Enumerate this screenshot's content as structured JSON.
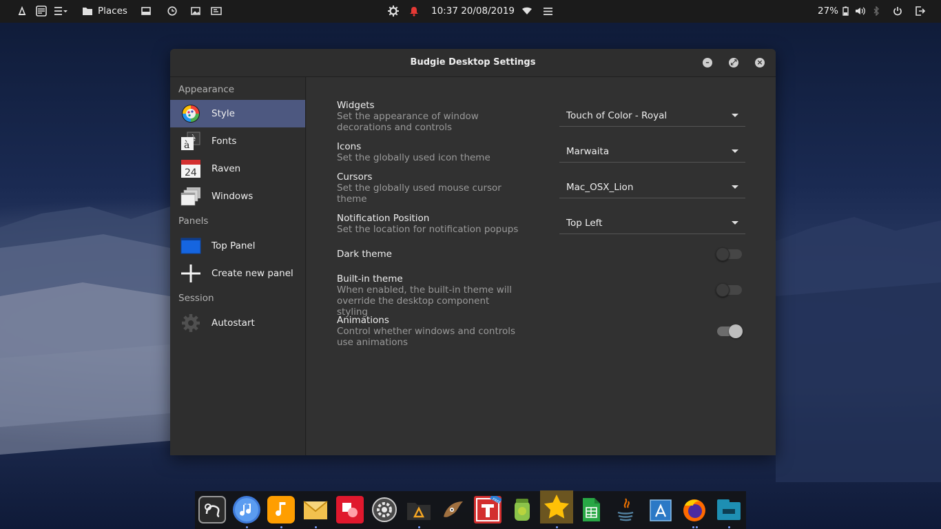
{
  "topbar": {
    "places_label": "Places",
    "clock": "10:37 20/08/2019",
    "battery": "27%"
  },
  "window": {
    "title": "Budgie Desktop Settings"
  },
  "sidebar": {
    "sections": [
      {
        "header": "Appearance"
      },
      {
        "header": "Panels"
      },
      {
        "header": "Session"
      }
    ],
    "items": [
      {
        "label": "Style",
        "icon": "palette-icon",
        "active": true
      },
      {
        "label": "Fonts",
        "icon": "font-icon"
      },
      {
        "label": "Raven",
        "icon": "calendar-icon",
        "calendar_day": "24"
      },
      {
        "label": "Windows",
        "icon": "windows-icon"
      },
      {
        "label": "Top Panel",
        "icon": "panel-icon"
      },
      {
        "label": "Create new panel",
        "icon": "plus-icon"
      },
      {
        "label": "Autostart",
        "icon": "gear-icon"
      }
    ]
  },
  "settings": {
    "widgets": {
      "title": "Widgets",
      "desc": "Set the appearance of window decorations and controls",
      "value": "Touch of Color - Royal"
    },
    "icons": {
      "title": "Icons",
      "desc": "Set the globally used icon theme",
      "value": "Marwaita"
    },
    "cursors": {
      "title": "Cursors",
      "desc": "Set the globally used mouse cursor theme",
      "value": "Mac_OSX_Lion"
    },
    "notification": {
      "title": "Notification Position",
      "desc": "Set the location for notification popups",
      "value": "Top Left"
    },
    "dark_theme": {
      "title": "Dark theme",
      "state": "off"
    },
    "builtin_theme": {
      "title": "Built-in theme",
      "desc": "When enabled, the built-in theme will override the desktop component styling",
      "state": "off"
    },
    "animations": {
      "title": "Animations",
      "desc": "Control whether windows and controls use animations",
      "state": "on"
    }
  },
  "dock": {
    "apps": [
      "inkscape-icon",
      "itunes-icon",
      "music-icon",
      "mail-icon",
      "shapes-icon",
      "settings-icon",
      "files-icon",
      "gimp-icon",
      "typora-icon",
      "jar-icon",
      "star-icon",
      "sheets-icon",
      "java-icon",
      "appstore-icon",
      "firefox-icon",
      "nautilus-icon"
    ],
    "tray_badge": "FREE"
  },
  "colors": {
    "accent": "#4d5880",
    "panel_blue": "#1565e0"
  }
}
